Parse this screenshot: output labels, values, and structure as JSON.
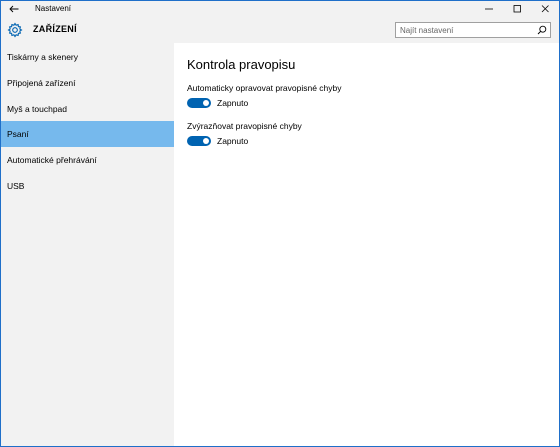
{
  "window": {
    "title": "Nastavení",
    "controls": {
      "minimize": "minimize-icon",
      "maximize": "maximize-icon",
      "close": "close-icon"
    }
  },
  "header": {
    "title": "ZAŘÍZENÍ",
    "icon": "gear-icon"
  },
  "search": {
    "placeholder": "Najít nastavení",
    "value": "",
    "icon": "search-icon"
  },
  "sidebar": {
    "items": [
      {
        "label": "Tiskárny a skenery",
        "active": false
      },
      {
        "label": "Připojená zařízení",
        "active": false
      },
      {
        "label": "Myš a touchpad",
        "active": false
      },
      {
        "label": "Psaní",
        "active": true
      },
      {
        "label": "Automatické přehrávání",
        "active": false
      },
      {
        "label": "USB",
        "active": false
      }
    ]
  },
  "main": {
    "section_title": "Kontrola pravopisu",
    "settings": [
      {
        "label": "Automaticky opravovat pravopisné chyby",
        "state": "Zapnuto",
        "on": true
      },
      {
        "label": "Zvýrazňovat pravopisné chyby",
        "state": "Zapnuto",
        "on": true
      }
    ]
  },
  "colors": {
    "accent": "#0063b1",
    "selected_item": "#76b9ed",
    "sidebar_bg": "#f2f2f2",
    "window_border": "#1f6fc9"
  }
}
